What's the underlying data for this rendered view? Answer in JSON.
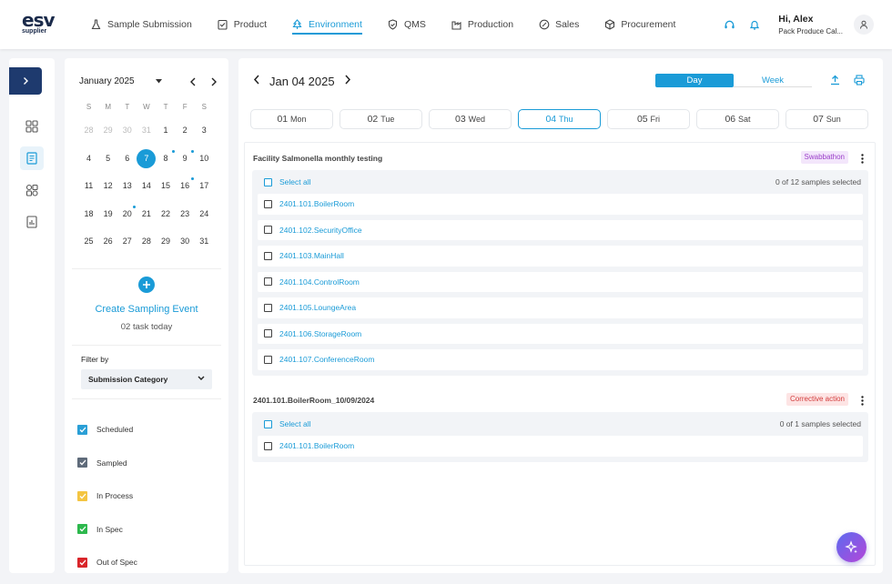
{
  "logo": {
    "line1": "esv",
    "line2": "supplier"
  },
  "nav": [
    {
      "label": "Sample Submission",
      "icon": "flask-icon",
      "active": false
    },
    {
      "label": "Product",
      "icon": "clipboard-icon",
      "active": false
    },
    {
      "label": "Environment",
      "icon": "tree-icon",
      "active": true
    },
    {
      "label": "QMS",
      "icon": "shield-icon",
      "active": false
    },
    {
      "label": "Production",
      "icon": "factory-icon",
      "active": false
    },
    {
      "label": "Sales",
      "icon": "tag-icon",
      "active": false
    },
    {
      "label": "Procurement",
      "icon": "box-icon",
      "active": false
    }
  ],
  "user": {
    "greeting": "Hi, Alex",
    "org": "Pack Produce Cal..."
  },
  "calendar": {
    "month": "January 2025",
    "dow": [
      "S",
      "M",
      "T",
      "W",
      "T",
      "F",
      "S"
    ],
    "weeks": [
      [
        {
          "d": "28",
          "m": true
        },
        {
          "d": "29",
          "m": true
        },
        {
          "d": "30",
          "m": true
        },
        {
          "d": "31",
          "m": true
        },
        {
          "d": "1"
        },
        {
          "d": "2"
        },
        {
          "d": "3"
        }
      ],
      [
        {
          "d": "4"
        },
        {
          "d": "5"
        },
        {
          "d": "6"
        },
        {
          "d": "7",
          "today": true
        },
        {
          "d": "8",
          "dot": true
        },
        {
          "d": "9",
          "dot": true
        },
        {
          "d": "10"
        }
      ],
      [
        {
          "d": "11"
        },
        {
          "d": "12"
        },
        {
          "d": "13"
        },
        {
          "d": "14"
        },
        {
          "d": "15"
        },
        {
          "d": "16",
          "dot": true
        },
        {
          "d": "17"
        }
      ],
      [
        {
          "d": "18"
        },
        {
          "d": "19"
        },
        {
          "d": "20",
          "dot": true
        },
        {
          "d": "21"
        },
        {
          "d": "22"
        },
        {
          "d": "23"
        },
        {
          "d": "24"
        }
      ],
      [
        {
          "d": "25"
        },
        {
          "d": "26"
        },
        {
          "d": "27"
        },
        {
          "d": "28"
        },
        {
          "d": "29"
        },
        {
          "d": "30"
        },
        {
          "d": "31"
        }
      ]
    ]
  },
  "create": {
    "title": "Create Sampling Event",
    "subtitle": "02 task today"
  },
  "filter": {
    "label": "Filter by",
    "value": "Submission Category"
  },
  "legend": [
    {
      "label": "Scheduled",
      "color": "#2a9fd6"
    },
    {
      "label": "Sampled",
      "color": "#5f6b7a"
    },
    {
      "label": "In Process",
      "color": "#f4c542"
    },
    {
      "label": "In Spec",
      "color": "#2db84d"
    },
    {
      "label": "Out of Spec",
      "color": "#d9252a"
    }
  ],
  "main": {
    "date_title": "Jan 04 2025",
    "view_day": "Day",
    "view_week": "Week",
    "days": [
      {
        "num": "01",
        "name": "Mon"
      },
      {
        "num": "02",
        "name": "Tue"
      },
      {
        "num": "03",
        "name": "Wed"
      },
      {
        "num": "04",
        "name": "Thu",
        "selected": true
      },
      {
        "num": "05",
        "name": "Fri"
      },
      {
        "num": "06",
        "name": "Sat"
      },
      {
        "num": "07",
        "name": "Sun"
      }
    ],
    "groups": [
      {
        "title": "Facility Salmonella monthly testing",
        "badge": "Swabbathon",
        "badge_bg": "#f3e6fb",
        "badge_color": "#9b3fc9",
        "select_all": "Select all",
        "count": "0 of 12 samples selected",
        "items": [
          "2401.101.BoilerRoom",
          "2401.102.SecurityOffice",
          "2401.103.MainHall",
          "2401.104.ControlRoom",
          "2401.105.LoungeArea",
          "2401.106.StorageRoom",
          "2401.107.ConferenceRoom"
        ]
      },
      {
        "title": "2401.101.BoilerRoom_10/09/2024",
        "badge": "Corrective action",
        "badge_bg": "#fde4e4",
        "badge_color": "#d23b3b",
        "select_all": "Select all",
        "count": "0 of 1 samples selected",
        "items": [
          "2401.101.BoilerRoom"
        ]
      }
    ]
  }
}
